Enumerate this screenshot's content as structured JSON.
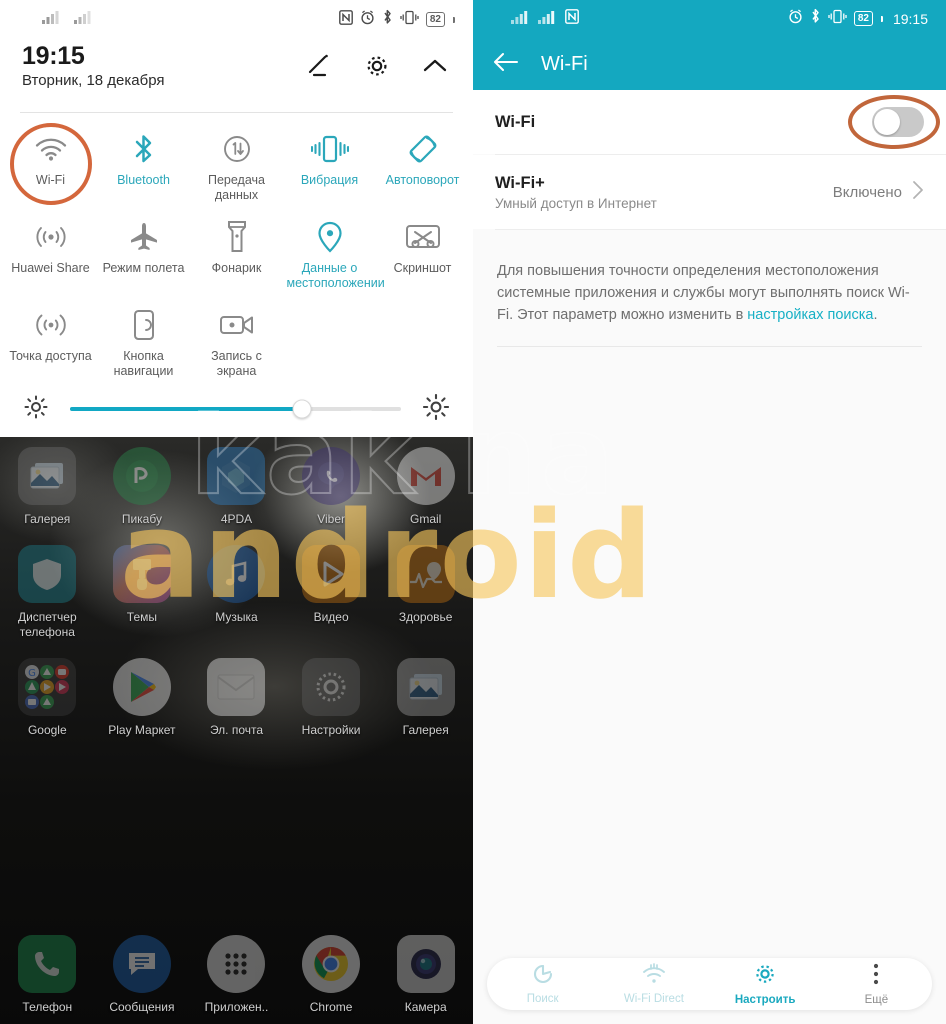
{
  "left": {
    "statusbar": {
      "signal_icons": [
        "signal-bars-sim1",
        "signal-bars-sim2"
      ],
      "icons": [
        "nfc-icon",
        "alarm-icon",
        "bluetooth-icon",
        "vibrate-icon"
      ],
      "battery": "82"
    },
    "clock": {
      "time": "19:15",
      "date": "Вторник, 18 декабря",
      "actions": [
        "edit-icon",
        "gear-icon",
        "collapse-chevron-icon"
      ]
    },
    "quick_settings": [
      {
        "label": "Wi-Fi",
        "icon": "wifi-icon",
        "state": "off",
        "highlighted": true
      },
      {
        "label": "Bluetooth",
        "icon": "bluetooth-icon",
        "state": "on",
        "highlighted": false
      },
      {
        "label": "Передача данных",
        "icon": "mobile-data-icon",
        "state": "off",
        "highlighted": false
      },
      {
        "label": "Вибрация",
        "icon": "vibrate-icon",
        "state": "on",
        "highlighted": false
      },
      {
        "label": "Автоповорот",
        "icon": "autorotate-icon",
        "state": "on",
        "highlighted": false
      },
      {
        "label": "Huawei Share",
        "icon": "huawei-share-icon",
        "state": "off",
        "highlighted": false
      },
      {
        "label": "Режим полета",
        "icon": "airplane-icon",
        "state": "off",
        "highlighted": false
      },
      {
        "label": "Фонарик",
        "icon": "flashlight-icon",
        "state": "off",
        "highlighted": false
      },
      {
        "label": "Данные о местоположении",
        "icon": "location-pin-icon",
        "state": "on",
        "highlighted": false
      },
      {
        "label": "Скриншот",
        "icon": "screenshot-icon",
        "state": "off",
        "highlighted": false
      },
      {
        "label": "Точка доступа",
        "icon": "hotspot-icon",
        "state": "off",
        "highlighted": false
      },
      {
        "label": "Кнопка навигации",
        "icon": "nav-button-icon",
        "state": "off",
        "highlighted": false
      },
      {
        "label": "Запись с экрана",
        "icon": "screen-record-icon",
        "state": "off",
        "highlighted": false
      }
    ],
    "brightness": {
      "low_icon": "brightness-low-icon",
      "high_icon": "brightness-high-icon",
      "value_percent": 70
    },
    "home": {
      "rows": [
        [
          {
            "label": "Галерея",
            "icon": "gallery-icon"
          },
          {
            "label": "Пикабу",
            "icon": "pikabu-icon"
          },
          {
            "label": "4PDA",
            "icon": "fourpda-icon"
          },
          {
            "label": "Viber",
            "icon": "viber-icon"
          },
          {
            "label": "Gmail",
            "icon": "gmail-icon"
          }
        ],
        [
          {
            "label": "Диспетчер телефона",
            "icon": "phone-manager-icon"
          },
          {
            "label": "Темы",
            "icon": "themes-icon"
          },
          {
            "label": "Музыка",
            "icon": "music-icon"
          },
          {
            "label": "Видео",
            "icon": "video-icon"
          },
          {
            "label": "Здоровье",
            "icon": "health-icon"
          }
        ],
        [
          {
            "label": "Google",
            "icon": "google-folder-icon"
          },
          {
            "label": "Play Маркет",
            "icon": "play-store-icon"
          },
          {
            "label": "Эл. почта",
            "icon": "email-icon"
          },
          {
            "label": "Настройки",
            "icon": "settings-icon"
          },
          {
            "label": "Галерея",
            "icon": "gallery-icon"
          }
        ]
      ],
      "dock": [
        {
          "label": "Телефон",
          "icon": "phone-icon"
        },
        {
          "label": "Сообщения",
          "icon": "messages-icon"
        },
        {
          "label": "Приложен..",
          "icon": "app-drawer-icon"
        },
        {
          "label": "Chrome",
          "icon": "chrome-icon"
        },
        {
          "label": "Камера",
          "icon": "camera-icon"
        }
      ]
    }
  },
  "right": {
    "statusbar": {
      "icons": [
        "alarm-icon",
        "bluetooth-icon",
        "vibrate-icon"
      ],
      "battery": "82",
      "time": "19:15"
    },
    "appbar": {
      "back_icon": "back-arrow-icon",
      "title": "Wi-Fi"
    },
    "rows": [
      {
        "title": "Wi-Fi",
        "desc": "",
        "value": "",
        "control": "toggle",
        "toggle_on": false,
        "highlighted": true
      },
      {
        "title": "Wi-Fi+",
        "desc": "Умный доступ в Интернет",
        "value": "Включено",
        "control": "chevron",
        "toggle_on": null,
        "highlighted": false
      }
    ],
    "note": {
      "text_before": "Для повышения точности определения местоположения системные приложения и службы могут выполнять поиск Wi-Fi. Этот параметр можно изменить в ",
      "link": "настройках поиска",
      "text_after": "."
    },
    "bottom_bar": [
      {
        "label": "Поиск",
        "icon": "refresh-scan-icon",
        "state": "muted"
      },
      {
        "label": "Wi-Fi Direct",
        "icon": "wifi-direct-icon",
        "state": "muted"
      },
      {
        "label": "Настроить",
        "icon": "gear-icon",
        "state": "active"
      },
      {
        "label": "Ещё",
        "icon": "more-vertical-icon",
        "state": "dark"
      }
    ]
  },
  "watermark": {
    "line1": "kak na",
    "line2": "android"
  },
  "colors": {
    "teal": "#14a8c0",
    "accent_highlight": "#c1663b",
    "toggle_on_text": "#2ba7ba",
    "slider_fill": "#12a8c4"
  }
}
